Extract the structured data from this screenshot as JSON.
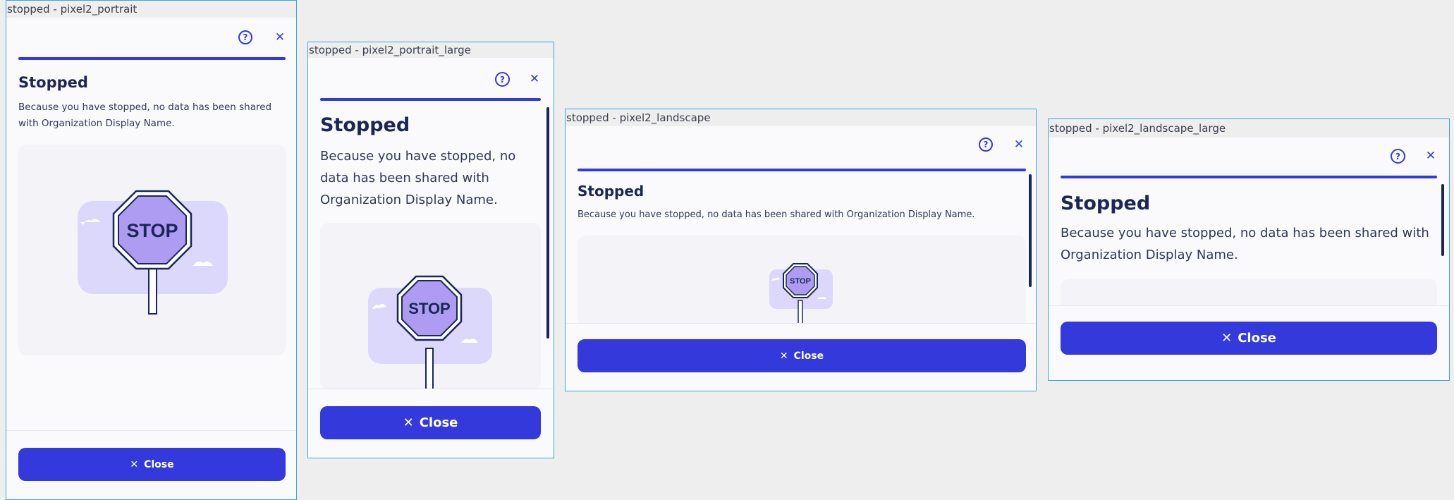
{
  "frames": [
    {
      "label": "stopped - pixel2_portrait"
    },
    {
      "label": "stopped - pixel2_portrait_large"
    },
    {
      "label": "stopped - pixel2_landscape"
    },
    {
      "label": "stopped - pixel2_landscape_large"
    }
  ],
  "dialog": {
    "title": "Stopped",
    "body": "Because you have stopped, no data has been shared with Organization Display Name.",
    "help_icon": "?",
    "close_icon": "✕",
    "close_button_icon": "✕",
    "close_button_label": "Close",
    "sign_text": "STOP"
  },
  "colors": {
    "accent": "#3439db",
    "title": "#1b2656",
    "frame_border": "#3aa7da",
    "sign_fill": "#ad9cf2",
    "sky": "#dcd8fb"
  },
  "icons": [
    "help-icon",
    "close-icon",
    "stop-sign-illustration"
  ]
}
